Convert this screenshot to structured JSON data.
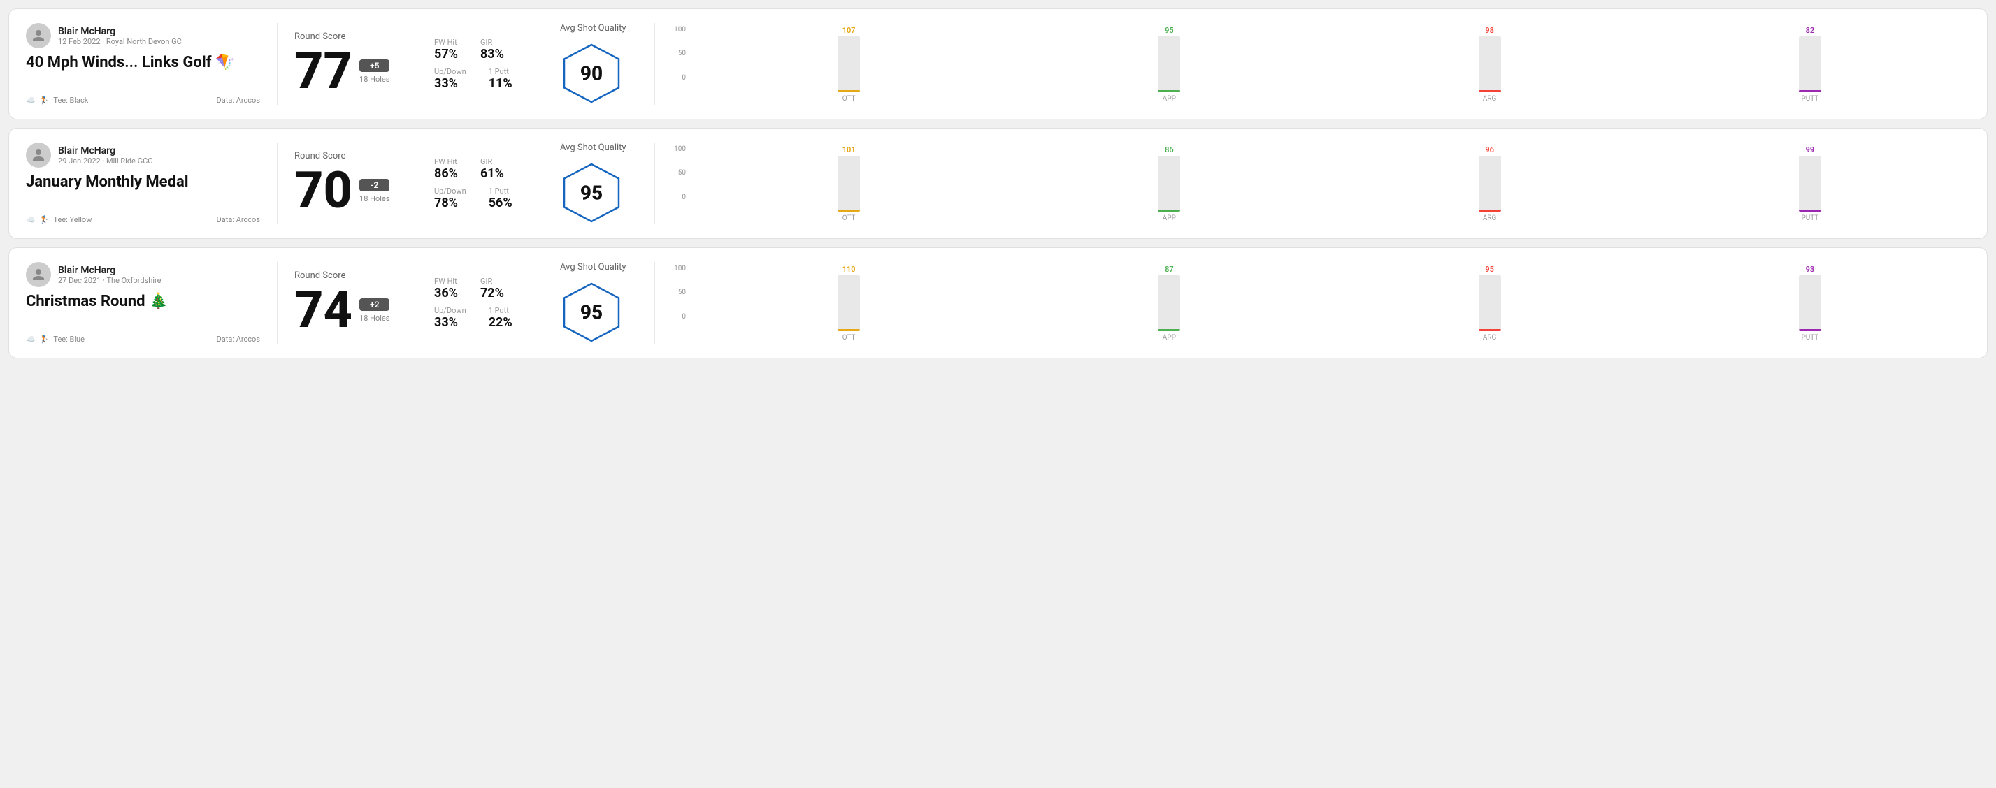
{
  "rounds": [
    {
      "id": "round-1",
      "user": "Blair McHarg",
      "date": "12 Feb 2022 · Royal North Devon GC",
      "title": "40 Mph Winds... Links Golf 🪁",
      "tee": "Black",
      "data_source": "Data: Arccos",
      "score": "77",
      "score_diff": "+5",
      "holes": "18 Holes",
      "fw_hit": "57%",
      "gir": "83%",
      "up_down": "33%",
      "one_putt": "11%",
      "avg_quality": "90",
      "chart": {
        "ott": {
          "value": 107,
          "label": "107",
          "bar_pct": 80
        },
        "app": {
          "value": 95,
          "label": "95",
          "bar_pct": 70
        },
        "arg": {
          "value": 98,
          "label": "98",
          "bar_pct": 73
        },
        "putt": {
          "value": 82,
          "label": "82",
          "bar_pct": 60
        }
      }
    },
    {
      "id": "round-2",
      "user": "Blair McHarg",
      "date": "29 Jan 2022 · Mill Ride GCC",
      "title": "January Monthly Medal",
      "tee": "Yellow",
      "data_source": "Data: Arccos",
      "score": "70",
      "score_diff": "-2",
      "holes": "18 Holes",
      "fw_hit": "86%",
      "gir": "61%",
      "up_down": "78%",
      "one_putt": "56%",
      "avg_quality": "95",
      "chart": {
        "ott": {
          "value": 101,
          "label": "101",
          "bar_pct": 76
        },
        "app": {
          "value": 86,
          "label": "86",
          "bar_pct": 64
        },
        "arg": {
          "value": 96,
          "label": "96",
          "bar_pct": 72
        },
        "putt": {
          "value": 99,
          "label": "99",
          "bar_pct": 74
        }
      }
    },
    {
      "id": "round-3",
      "user": "Blair McHarg",
      "date": "27 Dec 2021 · The Oxfordshire",
      "title": "Christmas Round 🎄",
      "tee": "Blue",
      "data_source": "Data: Arccos",
      "score": "74",
      "score_diff": "+2",
      "holes": "18 Holes",
      "fw_hit": "36%",
      "gir": "72%",
      "up_down": "33%",
      "one_putt": "22%",
      "avg_quality": "95",
      "chart": {
        "ott": {
          "value": 110,
          "label": "110",
          "bar_pct": 82
        },
        "app": {
          "value": 87,
          "label": "87",
          "bar_pct": 65
        },
        "arg": {
          "value": 95,
          "label": "95",
          "bar_pct": 71
        },
        "putt": {
          "value": 93,
          "label": "93",
          "bar_pct": 70
        }
      }
    }
  ],
  "chart_labels": {
    "ott": "OTT",
    "app": "APP",
    "arg": "ARG",
    "putt": "PUTT"
  },
  "chart_y_labels": [
    "100",
    "50",
    "0"
  ]
}
